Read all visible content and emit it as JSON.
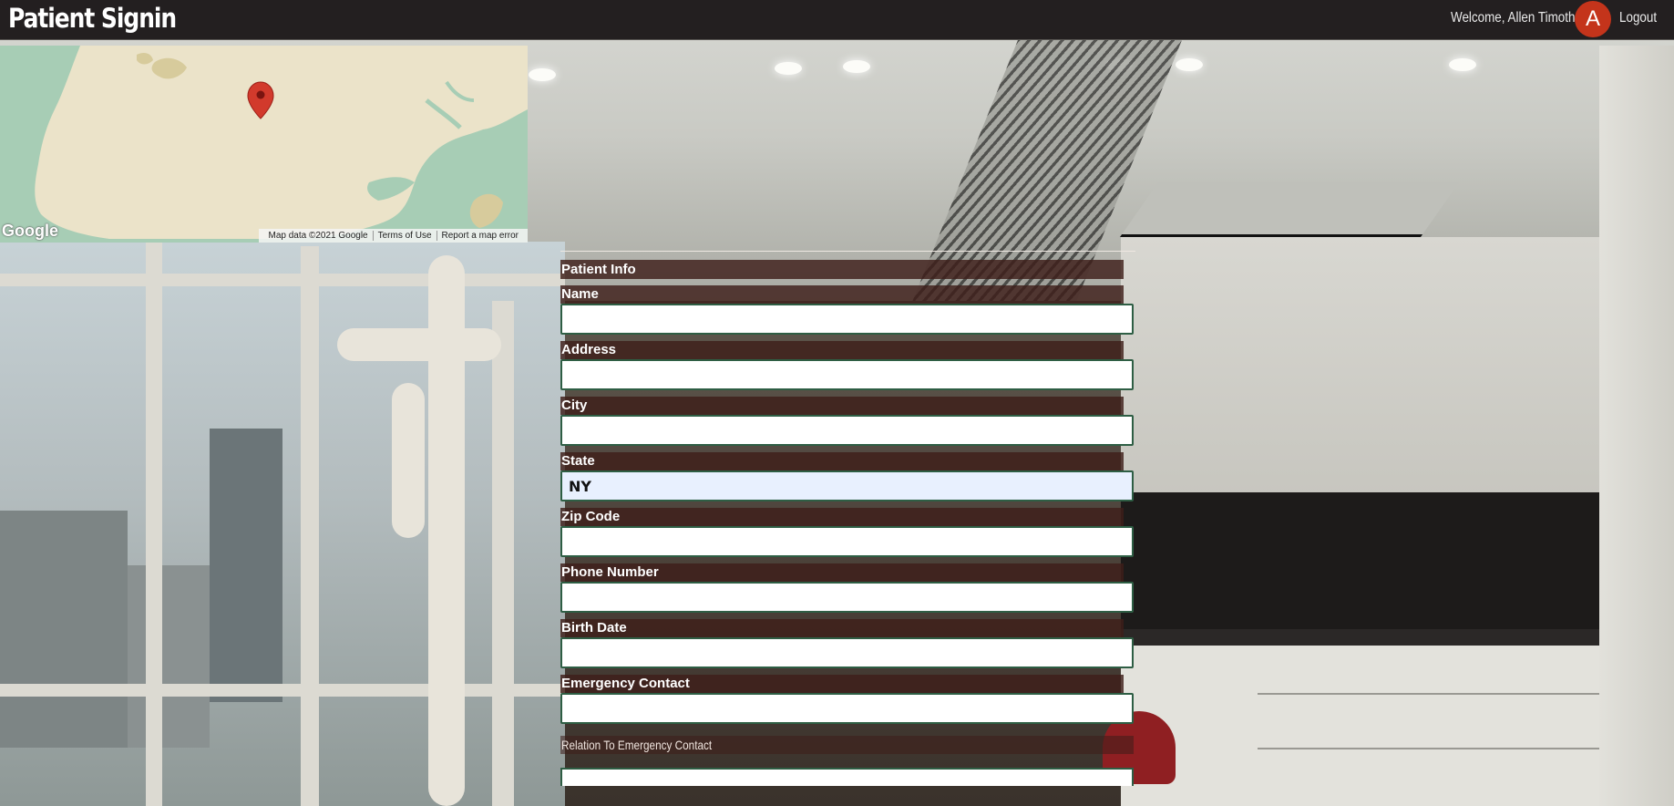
{
  "app": {
    "title": "Patient Signin"
  },
  "header": {
    "welcome_text": "Welcome, Allen Timothe",
    "avatar_initial": "A",
    "logout_label": "Logout"
  },
  "map": {
    "logo_text": "Google",
    "attribution": {
      "map_data": "Map data ©2021 Google",
      "terms": "Terms of Use",
      "report": "Report a map error"
    },
    "marker_icon": "map-pin-icon",
    "colors": {
      "land": "#ebe3c9",
      "water": "#a7cdb5",
      "park": "#d7cb9c",
      "marker": "#d23a2c"
    }
  },
  "form": {
    "section_title": "Patient Info",
    "fields": [
      {
        "label": "Name",
        "value": "",
        "placeholder": ""
      },
      {
        "label": "Address",
        "value": "",
        "placeholder": ""
      },
      {
        "label": "City",
        "value": "",
        "placeholder": ""
      },
      {
        "label": "State",
        "value": "NY",
        "placeholder": ""
      },
      {
        "label": "Zip Code",
        "value": "",
        "placeholder": ""
      },
      {
        "label": "Phone Number",
        "value": "",
        "placeholder": ""
      },
      {
        "label": "Birth Date",
        "value": "",
        "placeholder": ""
      },
      {
        "label": "Emergency Contact",
        "value": "",
        "placeholder": ""
      }
    ],
    "relation_label": "Relation To Emergency Contact"
  },
  "theme": {
    "topbar_bg": "#231f20",
    "avatar_bg": "#c4341b",
    "label_bg": "#3e1e1a",
    "input_border": "#2e5e44",
    "autofill_bg": "#e8f0fe"
  }
}
